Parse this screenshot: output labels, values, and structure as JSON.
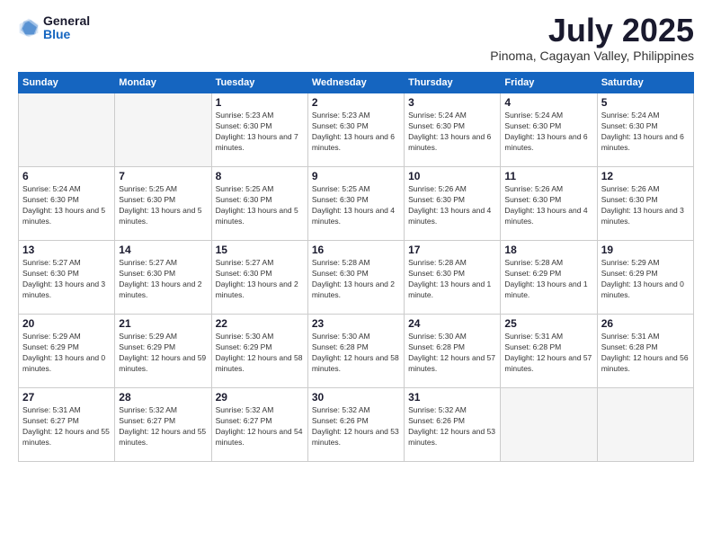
{
  "header": {
    "logo_general": "General",
    "logo_blue": "Blue",
    "month_title": "July 2025",
    "location": "Pinoma, Cagayan Valley, Philippines"
  },
  "weekdays": [
    "Sunday",
    "Monday",
    "Tuesday",
    "Wednesday",
    "Thursday",
    "Friday",
    "Saturday"
  ],
  "weeks": [
    [
      {
        "day": "",
        "info": ""
      },
      {
        "day": "",
        "info": ""
      },
      {
        "day": "1",
        "info": "Sunrise: 5:23 AM\nSunset: 6:30 PM\nDaylight: 13 hours and 7 minutes."
      },
      {
        "day": "2",
        "info": "Sunrise: 5:23 AM\nSunset: 6:30 PM\nDaylight: 13 hours and 6 minutes."
      },
      {
        "day": "3",
        "info": "Sunrise: 5:24 AM\nSunset: 6:30 PM\nDaylight: 13 hours and 6 minutes."
      },
      {
        "day": "4",
        "info": "Sunrise: 5:24 AM\nSunset: 6:30 PM\nDaylight: 13 hours and 6 minutes."
      },
      {
        "day": "5",
        "info": "Sunrise: 5:24 AM\nSunset: 6:30 PM\nDaylight: 13 hours and 6 minutes."
      }
    ],
    [
      {
        "day": "6",
        "info": "Sunrise: 5:24 AM\nSunset: 6:30 PM\nDaylight: 13 hours and 5 minutes."
      },
      {
        "day": "7",
        "info": "Sunrise: 5:25 AM\nSunset: 6:30 PM\nDaylight: 13 hours and 5 minutes."
      },
      {
        "day": "8",
        "info": "Sunrise: 5:25 AM\nSunset: 6:30 PM\nDaylight: 13 hours and 5 minutes."
      },
      {
        "day": "9",
        "info": "Sunrise: 5:25 AM\nSunset: 6:30 PM\nDaylight: 13 hours and 4 minutes."
      },
      {
        "day": "10",
        "info": "Sunrise: 5:26 AM\nSunset: 6:30 PM\nDaylight: 13 hours and 4 minutes."
      },
      {
        "day": "11",
        "info": "Sunrise: 5:26 AM\nSunset: 6:30 PM\nDaylight: 13 hours and 4 minutes."
      },
      {
        "day": "12",
        "info": "Sunrise: 5:26 AM\nSunset: 6:30 PM\nDaylight: 13 hours and 3 minutes."
      }
    ],
    [
      {
        "day": "13",
        "info": "Sunrise: 5:27 AM\nSunset: 6:30 PM\nDaylight: 13 hours and 3 minutes."
      },
      {
        "day": "14",
        "info": "Sunrise: 5:27 AM\nSunset: 6:30 PM\nDaylight: 13 hours and 2 minutes."
      },
      {
        "day": "15",
        "info": "Sunrise: 5:27 AM\nSunset: 6:30 PM\nDaylight: 13 hours and 2 minutes."
      },
      {
        "day": "16",
        "info": "Sunrise: 5:28 AM\nSunset: 6:30 PM\nDaylight: 13 hours and 2 minutes."
      },
      {
        "day": "17",
        "info": "Sunrise: 5:28 AM\nSunset: 6:30 PM\nDaylight: 13 hours and 1 minute."
      },
      {
        "day": "18",
        "info": "Sunrise: 5:28 AM\nSunset: 6:29 PM\nDaylight: 13 hours and 1 minute."
      },
      {
        "day": "19",
        "info": "Sunrise: 5:29 AM\nSunset: 6:29 PM\nDaylight: 13 hours and 0 minutes."
      }
    ],
    [
      {
        "day": "20",
        "info": "Sunrise: 5:29 AM\nSunset: 6:29 PM\nDaylight: 13 hours and 0 minutes."
      },
      {
        "day": "21",
        "info": "Sunrise: 5:29 AM\nSunset: 6:29 PM\nDaylight: 12 hours and 59 minutes."
      },
      {
        "day": "22",
        "info": "Sunrise: 5:30 AM\nSunset: 6:29 PM\nDaylight: 12 hours and 58 minutes."
      },
      {
        "day": "23",
        "info": "Sunrise: 5:30 AM\nSunset: 6:28 PM\nDaylight: 12 hours and 58 minutes."
      },
      {
        "day": "24",
        "info": "Sunrise: 5:30 AM\nSunset: 6:28 PM\nDaylight: 12 hours and 57 minutes."
      },
      {
        "day": "25",
        "info": "Sunrise: 5:31 AM\nSunset: 6:28 PM\nDaylight: 12 hours and 57 minutes."
      },
      {
        "day": "26",
        "info": "Sunrise: 5:31 AM\nSunset: 6:28 PM\nDaylight: 12 hours and 56 minutes."
      }
    ],
    [
      {
        "day": "27",
        "info": "Sunrise: 5:31 AM\nSunset: 6:27 PM\nDaylight: 12 hours and 55 minutes."
      },
      {
        "day": "28",
        "info": "Sunrise: 5:32 AM\nSunset: 6:27 PM\nDaylight: 12 hours and 55 minutes."
      },
      {
        "day": "29",
        "info": "Sunrise: 5:32 AM\nSunset: 6:27 PM\nDaylight: 12 hours and 54 minutes."
      },
      {
        "day": "30",
        "info": "Sunrise: 5:32 AM\nSunset: 6:26 PM\nDaylight: 12 hours and 53 minutes."
      },
      {
        "day": "31",
        "info": "Sunrise: 5:32 AM\nSunset: 6:26 PM\nDaylight: 12 hours and 53 minutes."
      },
      {
        "day": "",
        "info": ""
      },
      {
        "day": "",
        "info": ""
      }
    ]
  ]
}
